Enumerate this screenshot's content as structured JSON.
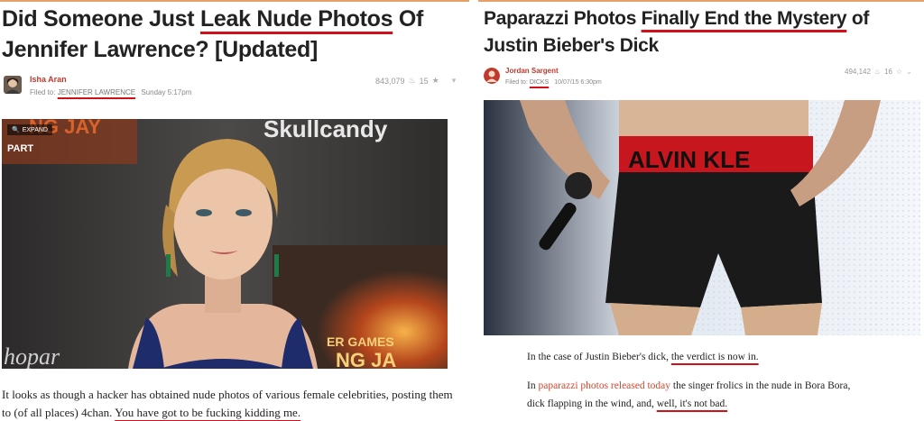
{
  "left": {
    "headline": {
      "pre": "Did Someone Just ",
      "highlight": "Leak Nude Photos",
      "post": " Of Jennifer Lawrence? [Updated]"
    },
    "author": "Isha Aran",
    "filed_prefix": "Filed to:",
    "filed_tag": "JENNIFER LAWRENCE",
    "date": "Sunday 5:17pm",
    "views": "843,079",
    "likes": "15",
    "expand_label": "EXPAND",
    "image": {
      "watermark_brand": "Skullcandy",
      "hunger_games": "ER GAMES",
      "hunger_games2": "NG JA",
      "corner_text": "hopar",
      "top_left_text": "NG JAY",
      "part_text": "PART"
    },
    "body": {
      "pre": "It looks as though a hacker has obtained nude photos of various female celebrities, posting them to (of all places) 4chan. ",
      "underlined": "You have got to be fucking kidding me."
    }
  },
  "right": {
    "headline": {
      "pre": "Paparazzi Photos ",
      "highlight": "Finally End the Mystery",
      "post": " of Justin Bieber's Dick"
    },
    "author": "Jordan Sargent",
    "filed_prefix": "Filed to:",
    "filed_tag": "DICKS",
    "date": "10/07/15 6:30pm",
    "views": "494,142",
    "likes": "16",
    "image": {
      "waistband_text": "ALVIN KLE"
    },
    "para1": {
      "pre": "In the case of Justin Bieber's dick, ",
      "underlined": "the verdict is now in."
    },
    "para2": {
      "pre": "In ",
      "link": "paparazzi photos released today",
      "mid": " the singer frolics in the nude in Bora Bora, dick flapping in the wind, and, ",
      "underlined": "well, it's not bad."
    }
  },
  "colors": {
    "accent_red": "#d0101a",
    "author_red": "#c0392b",
    "link_red": "#d9442b"
  }
}
